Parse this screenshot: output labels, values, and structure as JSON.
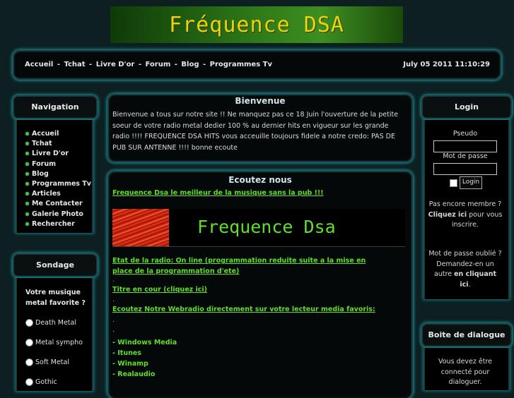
{
  "banner": {
    "title": "Fréquence DSA"
  },
  "topbar": {
    "menu": [
      "Accueil",
      "Tchat",
      "Livre D'or",
      "Forum",
      "Blog",
      "Programmes Tv"
    ],
    "separator": "-",
    "date": "July 05 2011 11:10:29"
  },
  "navigation": {
    "title": "Navigation",
    "items": [
      "Accueil",
      "Tchat",
      "Livre D'or",
      "Forum",
      "Blog",
      "Programmes Tv",
      "Articles",
      "Me Contacter",
      "Galerie Photo",
      "Rechercher"
    ]
  },
  "poll": {
    "title": "Sondage",
    "question": "Votre musique metal favorite ?",
    "options": [
      "Death Metal",
      "Metal sympho",
      "Soft Metal",
      "Gothic"
    ]
  },
  "welcome": {
    "title": "Bienvenue",
    "text": "Bienvenue a tous sur notre site !! Ne manquez pas ce 18 Juin l'ouverture de la petite soeur de votre radio metal dedier 100 % au dernier hits en vigueur sur les grande radio !!!! FREQUENCE DSA HITS vous acceuille toujours fidele a notre credo: PAS DE PUB SUR ANTENNE !!!! bonne ecoute"
  },
  "listen": {
    "title": "Ecoutez nous",
    "tagline": "Frequence Dsa le meilleur de la musique sans la pub !!!",
    "logo_text": "Frequence Dsa",
    "status": "Etat de la radio: On line (programmation reduite suite a la mise en place de la programmation d'ete)",
    "current_title": "Titre en cour (cliquez ici)",
    "webradio": "Ecoutez Notre Webradio directement sur votre lecteur media favoris:",
    "dot": ".",
    "players": [
      "- Windows Media",
      "- Itunes",
      "- Winamp",
      "- Realaudio"
    ]
  },
  "login": {
    "title": "Login",
    "pseudo_label": "Pseudo",
    "password_label": "Mot de passe",
    "button": "Login",
    "no_account_1": "Pas encore membre ?",
    "click_here": "Cliquez ici",
    "no_account_2": "pour vous inscrire.",
    "forgot_1": "Mot de passe oublié ?",
    "forgot_2": "Demandez-en un autre",
    "forgot_link": "en cliquant ici",
    "forgot_end": "."
  },
  "dialog": {
    "title": "Boite de dialogue",
    "text": "Vous devez être connecté pour dialoguer."
  },
  "colors": {
    "accent_glow": "#1ea0a8",
    "link_green": "#5fdf2a",
    "banner_yellow": "#e8d60a"
  }
}
